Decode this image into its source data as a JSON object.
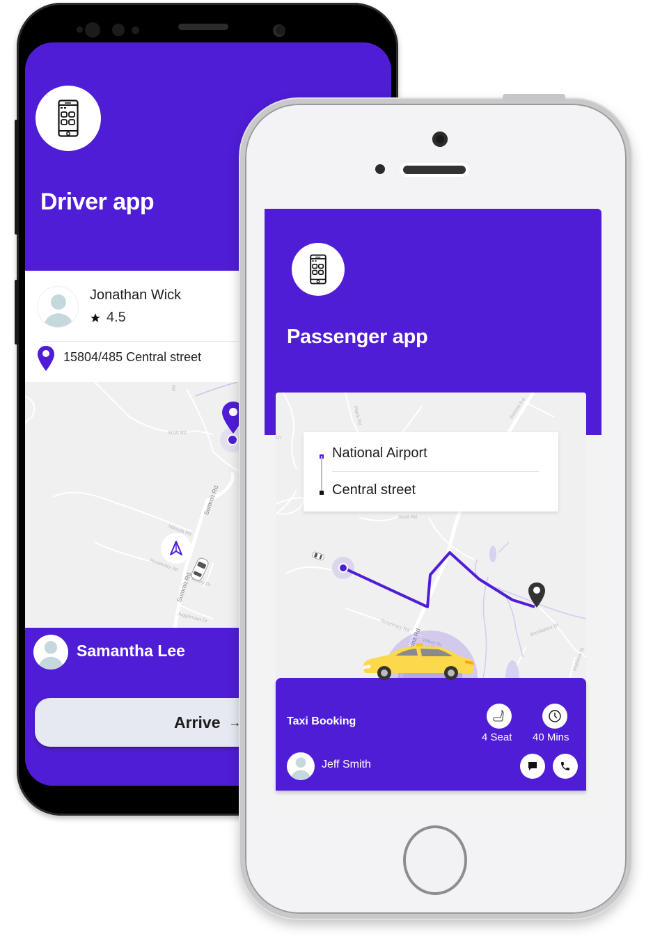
{
  "colors": {
    "brand_purple": "#4f1dd6",
    "map_bg": "#f0f0f1",
    "route_purple": "#4f1dd6",
    "destination_pin": "#333333",
    "taxi_yellow": "#fcd94a"
  },
  "driver_app": {
    "app_icon": "smartphone-apps-icon",
    "title": "Driver app",
    "driver": {
      "name": "Jonathan Wick",
      "rating_icon": "star-icon",
      "rating": "4.5",
      "avatar": "user-avatar-placeholder"
    },
    "pickup": {
      "icon": "location-pin-icon",
      "address": "15804/485 Central street"
    },
    "map": {
      "labels": [
        "Rd",
        "Scott Rd",
        "Summit Rd",
        "Mikayla Rd",
        "Rosemary Rd",
        "Summit Rd",
        "Wibey Dr",
        "Juggernaut Dr"
      ],
      "navigate_icon": "navigation-arrow-icon",
      "car_icon": "car-top-view-icon",
      "current_location_icon": "location-dot-icon"
    },
    "rider": {
      "name": "Samantha Lee",
      "avatar": "user-avatar-placeholder"
    },
    "action_button": {
      "label": "Arrive",
      "arrow": "→"
    }
  },
  "passenger_app": {
    "app_icon": "smartphone-apps-icon",
    "title": "Passenger app",
    "route": {
      "from": "National Airport",
      "to": "Central street"
    },
    "map": {
      "labels": [
        "Plank Rd",
        "Summit Rd",
        "Scott Rd",
        "Rosemary Rd",
        "Summit Rd",
        "Wibey Dr",
        "Brookshire Dr",
        "Matthew St",
        "Ln"
      ],
      "origin_icon": "location-dot-icon",
      "destination_icon": "map-pin-icon",
      "car_icon": "car-top-view-icon"
    },
    "booking": {
      "title": "Taxi Booking",
      "seats_icon": "car-seat-icon",
      "seats_label": "4 Seat",
      "time_icon": "clock-icon",
      "time_label": "40 Mins",
      "passenger_name": "Jeff Smith",
      "message_icon": "chat-icon",
      "call_icon": "phone-icon"
    }
  }
}
